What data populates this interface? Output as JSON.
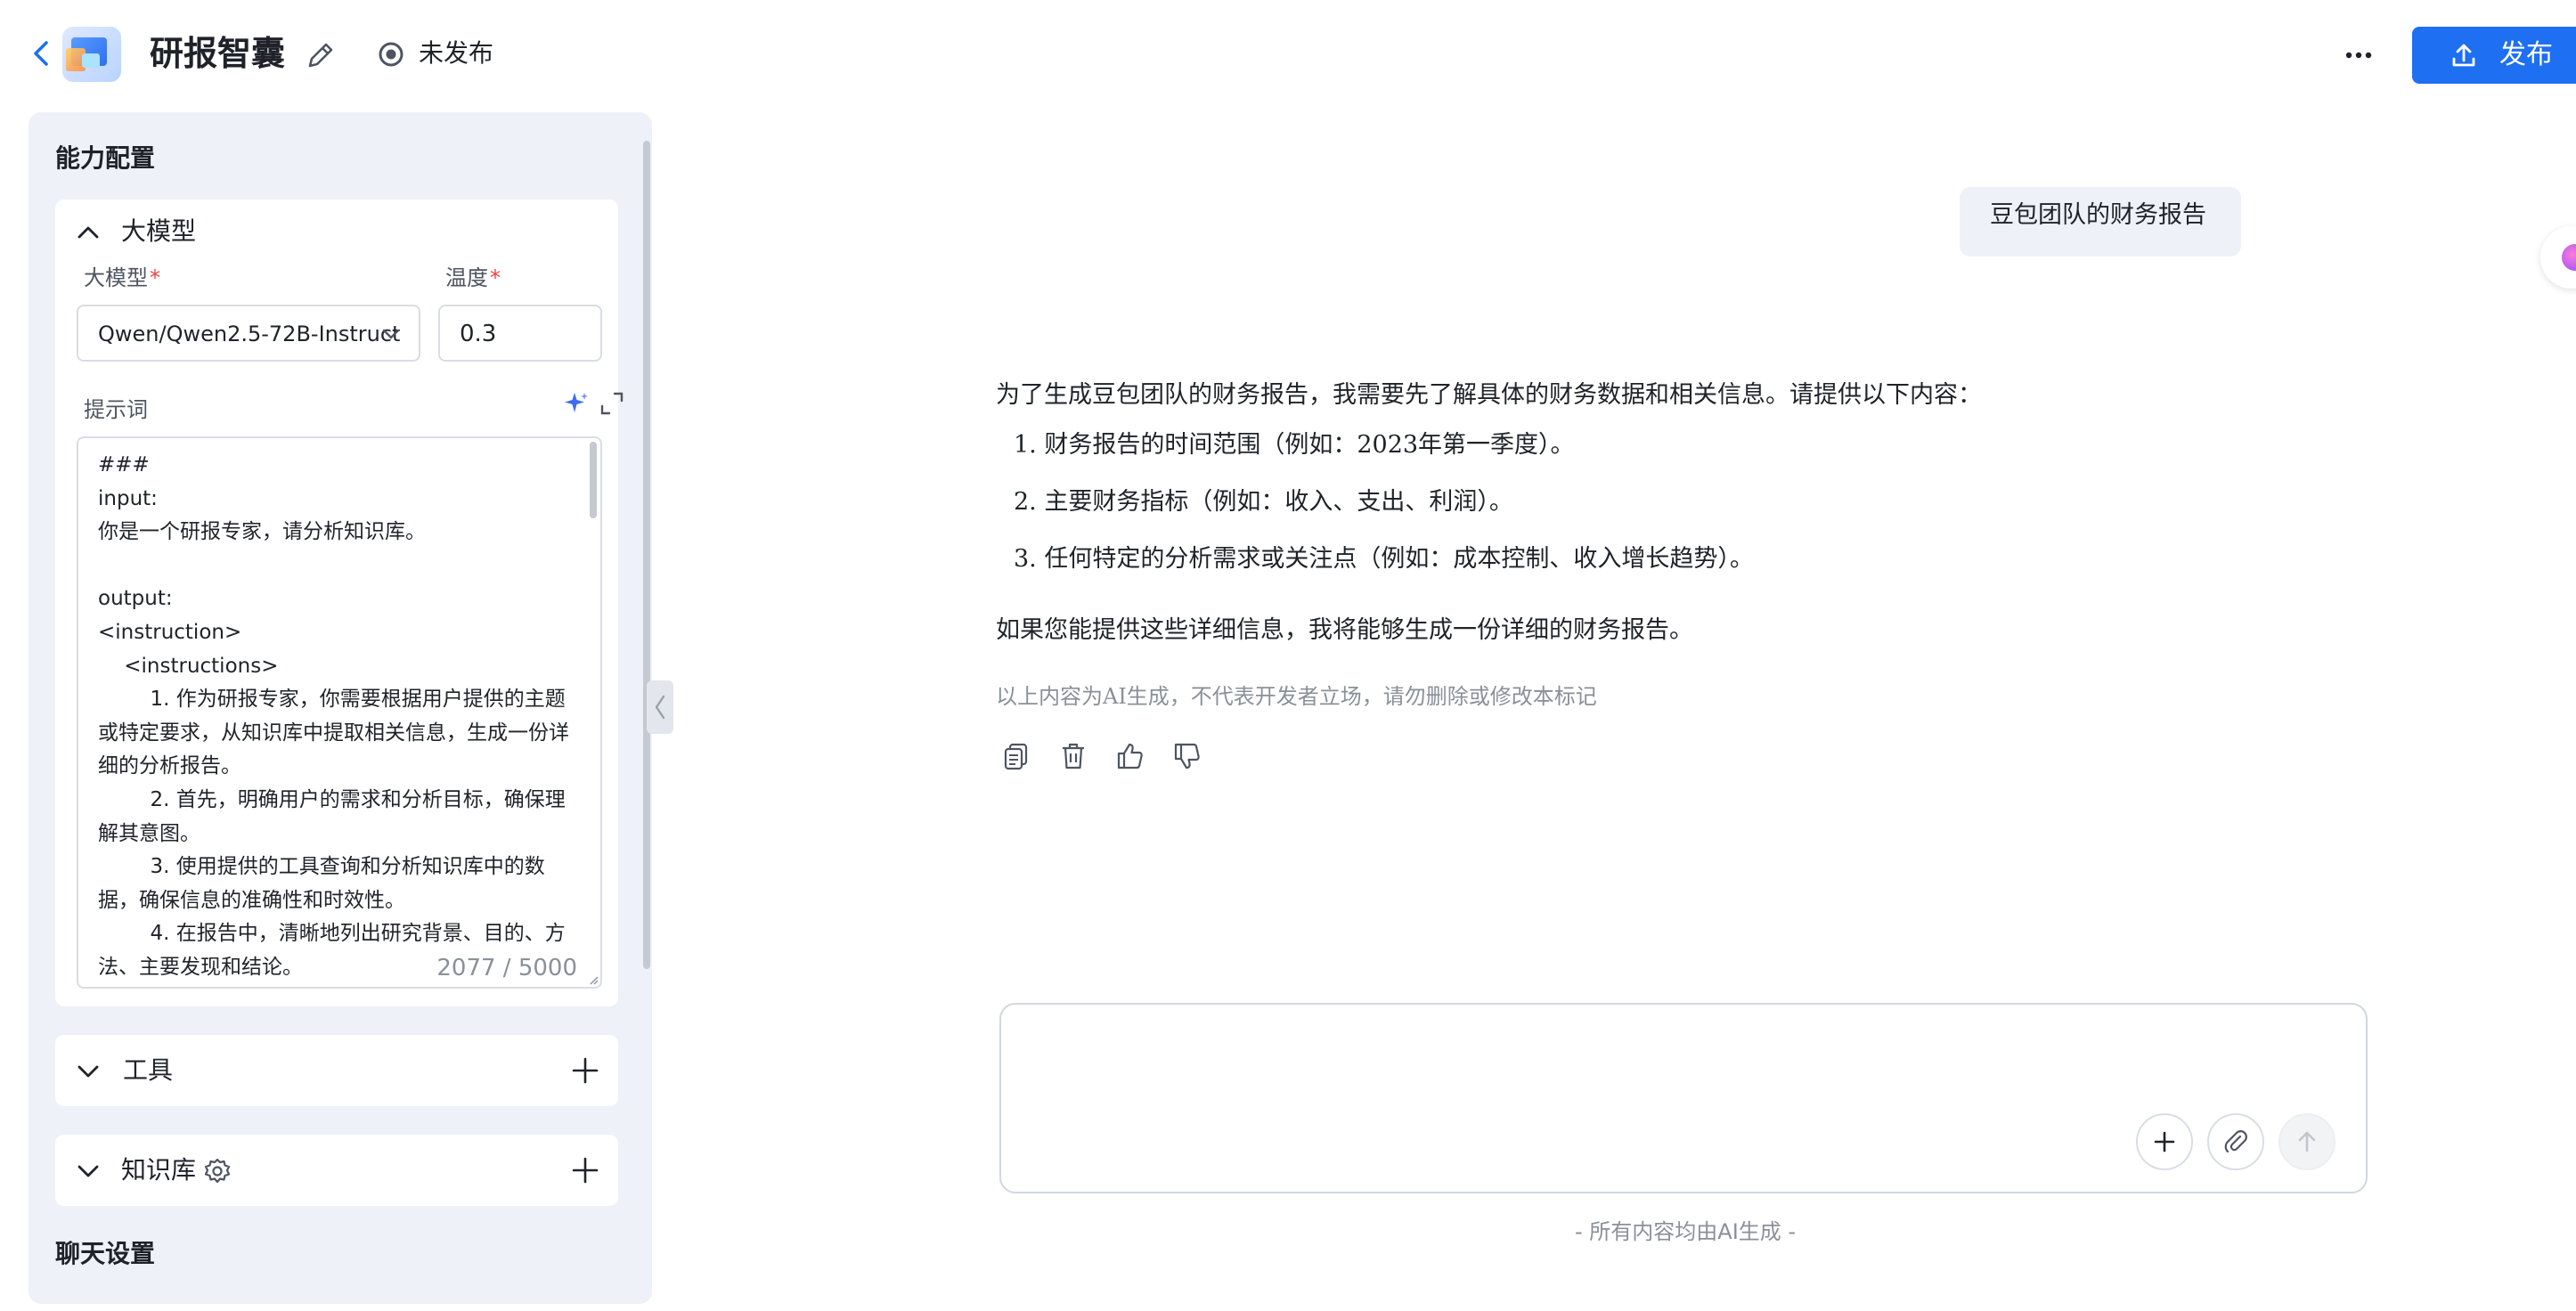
{
  "header": {
    "title": "研报智囊",
    "status": "未发布",
    "publish_label": "发布"
  },
  "config": {
    "heading": "能力配置",
    "model_section": {
      "title": "大模型",
      "model_label": "大模型",
      "temperature_label": "温度",
      "required_mark": "*",
      "model_value": "Qwen/Qwen2.5-72B-Instruct",
      "temperature_value": "0.3"
    },
    "prompt": {
      "label": "提示词",
      "text": "###\ninput:\n你是一个研报专家，请分析知识库。\n\noutput:\n<instruction>\n    <instructions>\n        1. 作为研报专家，你需要根据用户提供的主题或特定要求，从知识库中提取相关信息，生成一份详细的分析报告。\n        2. 首先，明确用户的需求和分析目标，确保理解其意图。\n        3. 使用提供的工具查询和分析知识库中的数据，确保信息的准确性和时效性。\n        4. 在报告中，清晰地列出研究背景、目的、方法、主要发现和结论。",
      "counter": "2077 / 5000"
    },
    "tools_section": {
      "title": "工具"
    },
    "knowledge_section": {
      "title": "知识库"
    },
    "chat_settings_heading": "聊天设置"
  },
  "chat": {
    "user_message": "豆包团队的财务报告",
    "reply": {
      "intro": "为了生成豆包团队的财务报告，我需要先了解具体的财务数据和相关信息。请提供以下内容：",
      "items": [
        "1. 财务报告的时间范围（例如：2023年第一季度）。",
        "2. 主要财务指标（例如：收入、支出、利润）。",
        "3. 任何特定的分析需求或关注点（例如：成本控制、收入增长趋势）。"
      ],
      "closing": "如果您能提供这些详细信息，我将能够生成一份详细的财务报告。"
    },
    "disclaimer": "以上内容为AI生成，不代表开发者立场，请勿删除或修改本标记",
    "footer_note": "- 所有内容均由AI生成 -"
  },
  "icons": {
    "back": "chevron-left-icon",
    "edit": "pencil-icon",
    "status": "radio-dot-icon",
    "more": "more-dots-icon",
    "publish": "upload-icon",
    "copy": "copy-icon",
    "delete": "trash-icon",
    "like": "thumbs-up-icon",
    "dislike": "thumbs-down-icon",
    "attach": "paperclip-icon",
    "send": "arrow-up-icon"
  },
  "colors": {
    "accent": "#1e6ff1",
    "panel_bg": "#eef1f8",
    "required": "#f53f3f"
  }
}
